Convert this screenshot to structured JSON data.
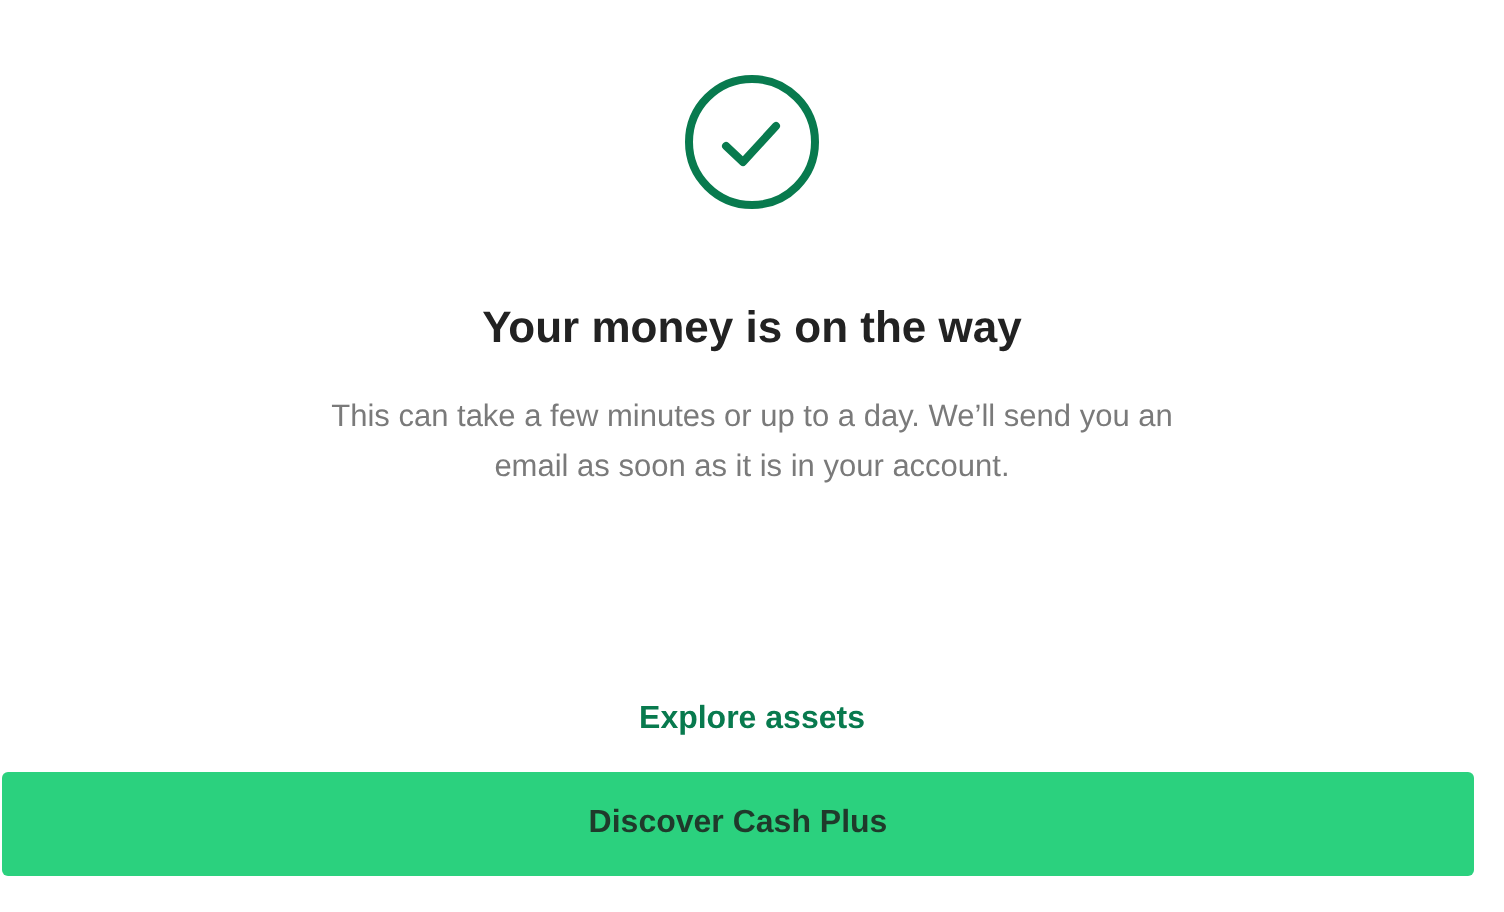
{
  "title": "Your money is on the way",
  "message": "This can take a few minutes or up to a day. We’ll send you an email as soon as it is in your account.",
  "link": "Explore assets",
  "button": "Discover Cash Plus"
}
